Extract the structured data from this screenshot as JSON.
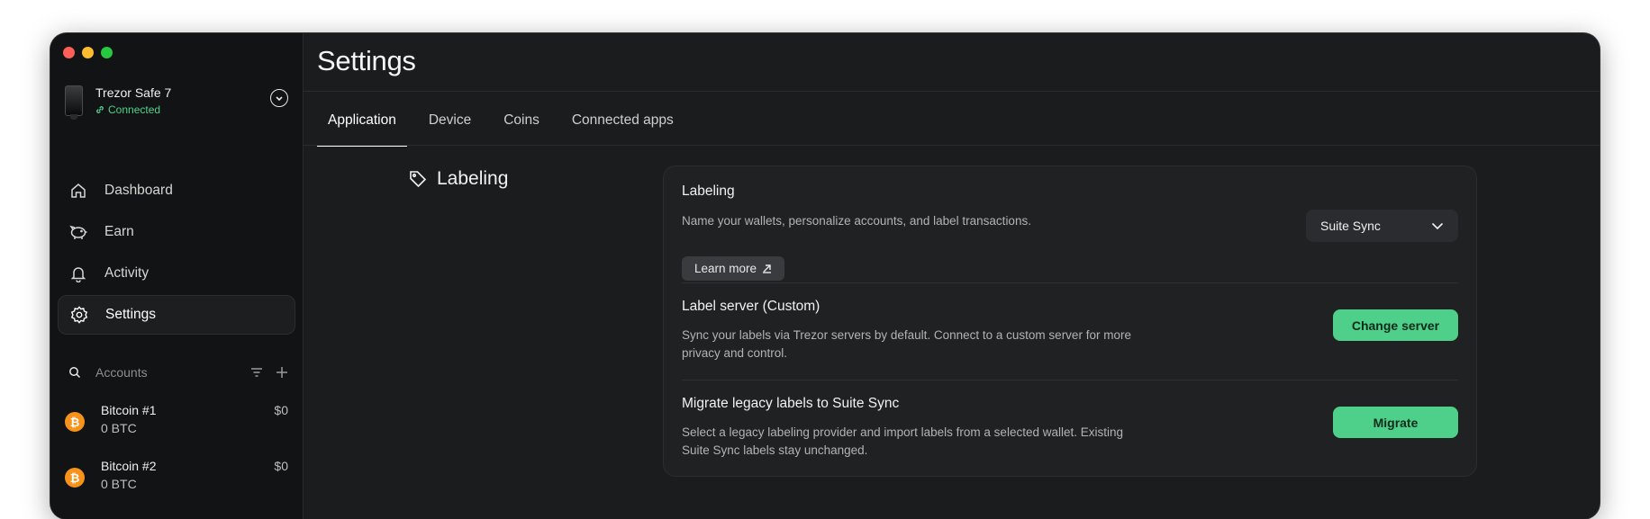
{
  "window": {
    "controls": [
      "close",
      "minimize",
      "maximize"
    ]
  },
  "device": {
    "name": "Trezor Safe 7",
    "status": "Connected",
    "status_color": "#4fd38a",
    "icons": {
      "status": "link-icon",
      "toggle": "chevron-down-circle-icon"
    }
  },
  "nav": [
    {
      "label": "Dashboard",
      "icon": "home-icon",
      "active": false
    },
    {
      "label": "Earn",
      "icon": "piggy-bank-icon",
      "active": false
    },
    {
      "label": "Activity",
      "icon": "bell-icon",
      "active": false
    },
    {
      "label": "Settings",
      "icon": "gear-icon",
      "active": true
    }
  ],
  "accounts": {
    "header": "Accounts",
    "icons": [
      "search-icon",
      "filter-icon",
      "plus-icon"
    ],
    "items": [
      {
        "name": "Bitcoin #1",
        "balance": "0 BTC",
        "fiat": "$0",
        "coin_icon": "bitcoin-icon"
      },
      {
        "name": "Bitcoin #2",
        "balance": "0 BTC",
        "fiat": "$0",
        "coin_icon": "bitcoin-icon"
      }
    ]
  },
  "page": {
    "title": "Settings",
    "tabs": [
      "Application",
      "Device",
      "Coins",
      "Connected apps"
    ],
    "active_tab": "Application"
  },
  "section": {
    "title": "Labeling",
    "icon": "tag-icon"
  },
  "card": {
    "labeling": {
      "title": "Labeling",
      "description": "Name your wallets, personalize accounts, and label transactions.",
      "learn_more": "Learn more",
      "learn_more_icon": "external-link-icon",
      "select_value": "Suite Sync"
    },
    "label_server": {
      "title": "Label server (Custom)",
      "description": "Sync your labels via Trezor servers by default. Connect to a custom server for more privacy and control.",
      "button": "Change server"
    },
    "migrate": {
      "title": "Migrate legacy labels to Suite Sync",
      "description": "Select a legacy labeling provider and import labels from a selected wallet. Existing Suite Sync labels stay unchanged.",
      "button": "Migrate"
    }
  },
  "colors": {
    "accent_green": "#4ed08a",
    "bitcoin": "#f7931a",
    "background": "#1b1c1e"
  }
}
